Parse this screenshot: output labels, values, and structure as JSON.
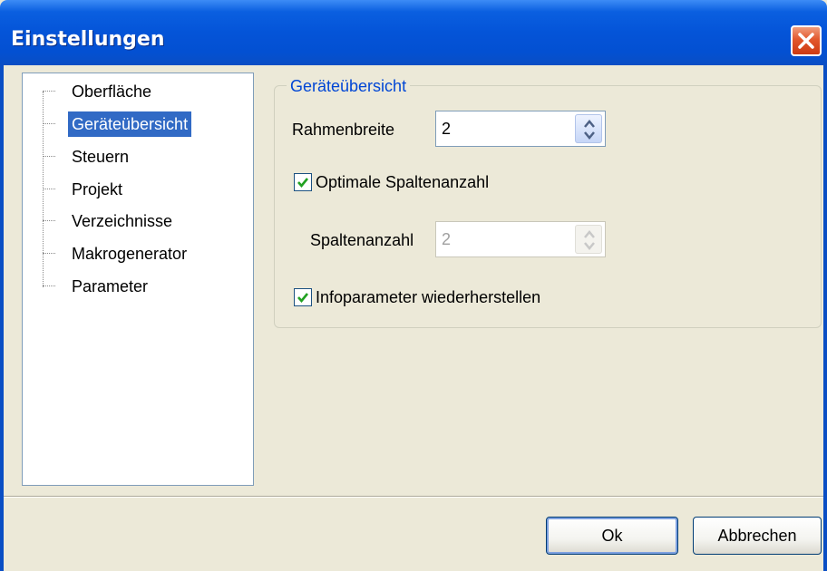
{
  "window": {
    "title": "Einstellungen"
  },
  "tree": {
    "items": [
      {
        "label": "Oberfläche",
        "selected": false
      },
      {
        "label": "Geräteübersicht",
        "selected": true
      },
      {
        "label": "Steuern",
        "selected": false
      },
      {
        "label": "Projekt",
        "selected": false
      },
      {
        "label": "Verzeichnisse",
        "selected": false
      },
      {
        "label": "Makrogenerator",
        "selected": false
      },
      {
        "label": "Parameter",
        "selected": false
      }
    ]
  },
  "panel": {
    "group_title": "Geräteübersicht",
    "frame_width": {
      "label": "Rahmenbreite",
      "value": "2"
    },
    "optimal_columns": {
      "label": "Optimale Spaltenanzahl",
      "checked": true
    },
    "column_count": {
      "label": "Spaltenanzahl",
      "value": "2",
      "disabled": true
    },
    "restore_info": {
      "label": "Infoparameter wiederherstellen",
      "checked": true
    }
  },
  "buttons": {
    "ok": "Ok",
    "cancel": "Abbrechen"
  },
  "icons": {
    "close": "close-icon",
    "spin_up": "arrow-up-icon",
    "spin_down": "arrow-down-icon",
    "check": "checkmark-icon"
  },
  "colors": {
    "title_bar": "#0454d8",
    "selection": "#316ac5",
    "group_title": "#0046d5",
    "close": "#e2572c"
  }
}
